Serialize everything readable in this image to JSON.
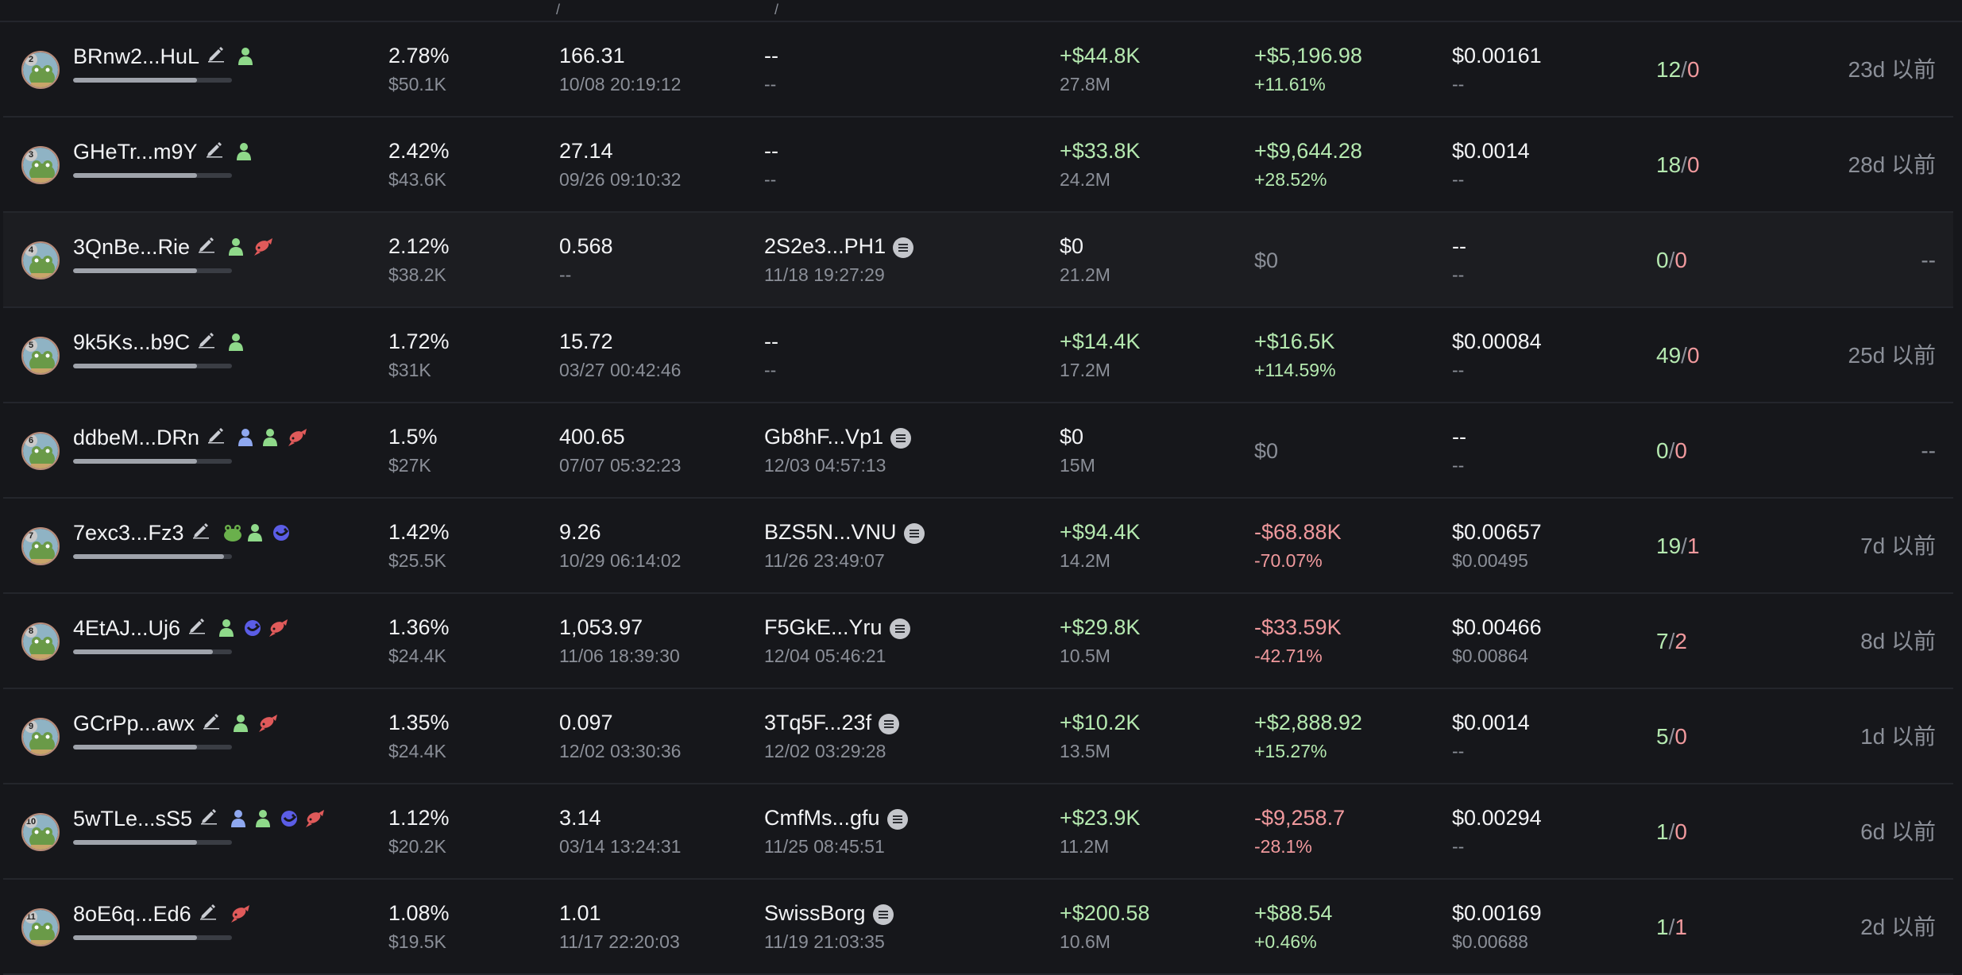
{
  "colors": {
    "background": "#16171b",
    "row_alt": "#1c1d21",
    "positive": "#b5e9b0",
    "negative": "#f0999d",
    "muted": "#8b8f98",
    "text": "#f2f3f5"
  },
  "top_fragment": {
    "a": "--",
    "b": "/",
    "c": "/"
  },
  "rows": [
    {
      "rank": "2",
      "address": "BRnw2...HuL",
      "holding_pct": 0.78,
      "tags": [
        "user-green"
      ],
      "pct": "2.78%",
      "value": "$50.1K",
      "bought": "166.31",
      "bought_time": "10/08 20:19:12",
      "source": "--",
      "source_time": "--",
      "has_source_icon": false,
      "vol": "+$44.8K",
      "vol_sub": "27.8M",
      "vol_color": "positive",
      "pnl": "+$5,196.98",
      "pnl_pct": "+11.61%",
      "pnl_color": "positive",
      "price": "$0.00161",
      "price_sub": "--",
      "buys": "12",
      "sells": "0",
      "ago": "23d 以前"
    },
    {
      "rank": "3",
      "address": "GHeTr...m9Y",
      "holding_pct": 0.78,
      "tags": [
        "user-green"
      ],
      "pct": "2.42%",
      "value": "$43.6K",
      "bought": "27.14",
      "bought_time": "09/26 09:10:32",
      "source": "--",
      "source_time": "--",
      "has_source_icon": false,
      "vol": "+$33.8K",
      "vol_sub": "24.2M",
      "vol_color": "positive",
      "pnl": "+$9,644.28",
      "pnl_pct": "+28.52%",
      "pnl_color": "positive",
      "price": "$0.0014",
      "price_sub": "--",
      "buys": "18",
      "sells": "0",
      "ago": "28d 以前"
    },
    {
      "rank": "4",
      "address": "3QnBe...Rie",
      "holding_pct": 0.78,
      "tags": [
        "user-green",
        "fish"
      ],
      "pct": "2.12%",
      "value": "$38.2K",
      "bought": "0.568",
      "bought_time": "--",
      "source": "2S2e3...PH1",
      "source_time": "11/18 19:27:29",
      "has_source_icon": true,
      "vol": "$0",
      "vol_sub": "21.2M",
      "vol_color": "text",
      "pnl": "$0",
      "pnl_pct": "",
      "pnl_color": "muted",
      "price": "--",
      "price_sub": "--",
      "buys": "0",
      "sells": "0",
      "ago": "--"
    },
    {
      "rank": "5",
      "address": "9k5Ks...b9C",
      "holding_pct": 0.78,
      "tags": [
        "user-green"
      ],
      "pct": "1.72%",
      "value": "$31K",
      "bought": "15.72",
      "bought_time": "03/27 00:42:46",
      "source": "--",
      "source_time": "--",
      "has_source_icon": false,
      "vol": "+$14.4K",
      "vol_sub": "17.2M",
      "vol_color": "positive",
      "pnl": "+$16.5K",
      "pnl_pct": "+114.59%",
      "pnl_color": "positive",
      "price": "$0.00084",
      "price_sub": "--",
      "buys": "49",
      "sells": "0",
      "ago": "25d 以前"
    },
    {
      "rank": "6",
      "address": "ddbeM...DRn",
      "holding_pct": 0.78,
      "tags": [
        "user-blue",
        "user-green",
        "fish"
      ],
      "pct": "1.5%",
      "value": "$27K",
      "bought": "400.65",
      "bought_time": "07/07 05:32:23",
      "source": "Gb8hF...Vp1",
      "source_time": "12/03 04:57:13",
      "has_source_icon": true,
      "vol": "$0",
      "vol_sub": "15M",
      "vol_color": "text",
      "pnl": "$0",
      "pnl_pct": "",
      "pnl_color": "muted",
      "price": "--",
      "price_sub": "--",
      "buys": "0",
      "sells": "0",
      "ago": "--"
    },
    {
      "rank": "7",
      "address": "7exc3...Fz3",
      "holding_pct": 0.95,
      "tags": [
        "frog",
        "user-green",
        "whale"
      ],
      "pct": "1.42%",
      "value": "$25.5K",
      "bought": "9.26",
      "bought_time": "10/29 06:14:02",
      "source": "BZS5N...VNU",
      "source_time": "11/26 23:49:07",
      "has_source_icon": true,
      "vol": "+$94.4K",
      "vol_sub": "14.2M",
      "vol_color": "positive",
      "pnl": "-$68.88K",
      "pnl_pct": "-70.07%",
      "pnl_color": "negative",
      "price": "$0.00657",
      "price_sub": "$0.00495",
      "buys": "19",
      "sells": "1",
      "ago": "7d 以前"
    },
    {
      "rank": "8",
      "address": "4EtAJ...Uj6",
      "holding_pct": 0.88,
      "tags": [
        "user-green",
        "whale",
        "fish"
      ],
      "pct": "1.36%",
      "value": "$24.4K",
      "bought": "1,053.97",
      "bought_time": "11/06 18:39:30",
      "source": "F5GkE...Yru",
      "source_time": "12/04 05:46:21",
      "has_source_icon": true,
      "vol": "+$29.8K",
      "vol_sub": "10.5M",
      "vol_color": "positive",
      "pnl": "-$33.59K",
      "pnl_pct": "-42.71%",
      "pnl_color": "negative",
      "price": "$0.00466",
      "price_sub": "$0.00864",
      "buys": "7",
      "sells": "2",
      "ago": "8d 以前"
    },
    {
      "rank": "9",
      "address": "GCrPp...awx",
      "holding_pct": 0.78,
      "tags": [
        "user-green",
        "fish"
      ],
      "pct": "1.35%",
      "value": "$24.4K",
      "bought": "0.097",
      "bought_time": "12/02 03:30:36",
      "source": "3Tq5F...23f",
      "source_time": "12/02 03:29:28",
      "has_source_icon": true,
      "vol": "+$10.2K",
      "vol_sub": "13.5M",
      "vol_color": "positive",
      "pnl": "+$2,888.92",
      "pnl_pct": "+15.27%",
      "pnl_color": "positive",
      "price": "$0.0014",
      "price_sub": "--",
      "buys": "5",
      "sells": "0",
      "ago": "1d 以前"
    },
    {
      "rank": "10",
      "address": "5wTLe...sS5",
      "holding_pct": 0.78,
      "tags": [
        "user-blue",
        "user-green",
        "whale",
        "fish"
      ],
      "pct": "1.12%",
      "value": "$20.2K",
      "bought": "3.14",
      "bought_time": "03/14 13:24:31",
      "source": "CmfMs...gfu",
      "source_time": "11/25 08:45:51",
      "has_source_icon": true,
      "vol": "+$23.9K",
      "vol_sub": "11.2M",
      "vol_color": "positive",
      "pnl": "-$9,258.7",
      "pnl_pct": "-28.1%",
      "pnl_color": "negative",
      "price": "$0.00294",
      "price_sub": "--",
      "buys": "1",
      "sells": "0",
      "ago": "6d 以前"
    },
    {
      "rank": "11",
      "address": "8oE6q...Ed6",
      "holding_pct": 0.78,
      "tags": [
        "fish"
      ],
      "pct": "1.08%",
      "value": "$19.5K",
      "bought": "1.01",
      "bought_time": "11/17 22:20:03",
      "source": "SwissBorg",
      "source_time": "11/19 21:03:35",
      "has_source_icon": true,
      "vol": "+$200.58",
      "vol_sub": "10.6M",
      "vol_color": "positive",
      "pnl": "+$88.54",
      "pnl_pct": "+0.46%",
      "pnl_color": "positive",
      "price": "$0.00169",
      "price_sub": "$0.00688",
      "buys": "1",
      "sells": "1",
      "ago": "2d 以前"
    }
  ]
}
